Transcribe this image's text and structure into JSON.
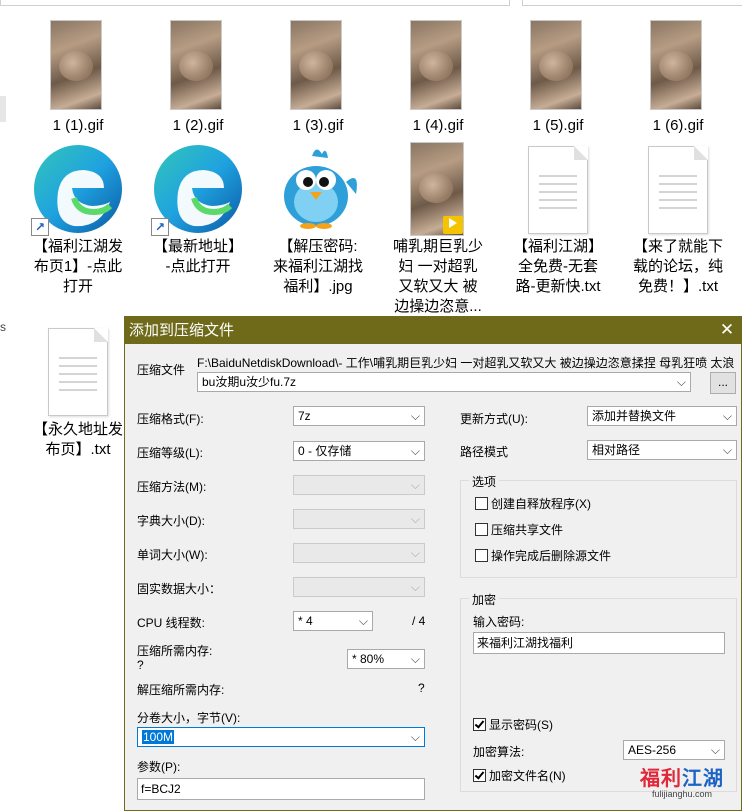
{
  "explorer": {
    "files": [
      {
        "name": "1 (1).gif"
      },
      {
        "name": "1 (2).gif"
      },
      {
        "name": "1 (3).gif"
      },
      {
        "name": "1 (4).gif"
      },
      {
        "name": "1 (5).gif"
      },
      {
        "name": "1 (6).gif"
      },
      {
        "name_lines": [
          "【福利江湖发",
          "布页1】-点此",
          "打开"
        ]
      },
      {
        "name_lines": [
          "【最新地址】",
          "-点此打开"
        ]
      },
      {
        "name_lines": [
          "【解压密码:",
          "来福利江湖找",
          "福利】.jpg"
        ]
      },
      {
        "name_lines": [
          "哺乳期巨乳少",
          "妇 一对超乳",
          "又软又大 被",
          "边操边恣意..."
        ]
      },
      {
        "name_lines": [
          "【福利江湖】",
          "全免费-无套",
          "路-更新快.txt"
        ]
      },
      {
        "name_lines": [
          "【来了就能下",
          "载的论坛，纯",
          "免费！】.txt"
        ]
      },
      {
        "name_lines": [
          "【永久地址发",
          "布页】.txt"
        ]
      }
    ],
    "left_mark": "s",
    "player_badge": "Player"
  },
  "dialog": {
    "title": "添加到压缩文件",
    "close": "✕",
    "archive_label": "压缩文件",
    "archive_path": "F:\\BaiduNetdiskDownload\\-      工作\\哺乳期巨乳少妇 一对超乳又软又大 被边操边恣意揉捏 母乳狂喷 太浪",
    "archive_name": "bu汝期u汝少fu.7z",
    "browse_label": "...",
    "format_label": "压缩格式(F):",
    "format_value": "7z",
    "level_label": "压缩等级(L):",
    "level_value": "0 - 仅存储",
    "method_label": "压缩方法(M):",
    "dict_label": "字典大小(D):",
    "word_label": "单词大小(W):",
    "solid_label": "固实数据大小：",
    "cpu_label": "CPU 线程数:",
    "cpu_value": "* 4",
    "cpu_total": "/ 4",
    "mem_label": "压缩所需内存:",
    "mem_q": "?",
    "mem_value": "* 80%",
    "decomp_label": "解压缩所需内存:",
    "decomp_value": "?",
    "volume_label": "分卷大小，字节(V):",
    "volume_value": "100M",
    "params_label": "参数(P):",
    "params_value": "f=BCJ2",
    "update_label": "更新方式(U):",
    "update_value": "添加并替换文件",
    "path_label": "路径模式",
    "path_value": "相对路径",
    "options_title": "选项",
    "opt_sfx": "创建自释放程序(X)",
    "opt_shared": "压缩共享文件",
    "opt_delete": "操作完成后删除源文件",
    "enc_title": "加密",
    "enc_pw_label": "输入密码:",
    "enc_pw_value": "来福利江湖找福利",
    "show_pw": "显示密码(S)",
    "enc_method_label": "加密算法:",
    "enc_method_value": "AES-256",
    "enc_names": "加密文件名(N)"
  },
  "watermark": {
    "text_red": "福利",
    "text_blue": "江湖",
    "url": "fulijianghu.com"
  }
}
